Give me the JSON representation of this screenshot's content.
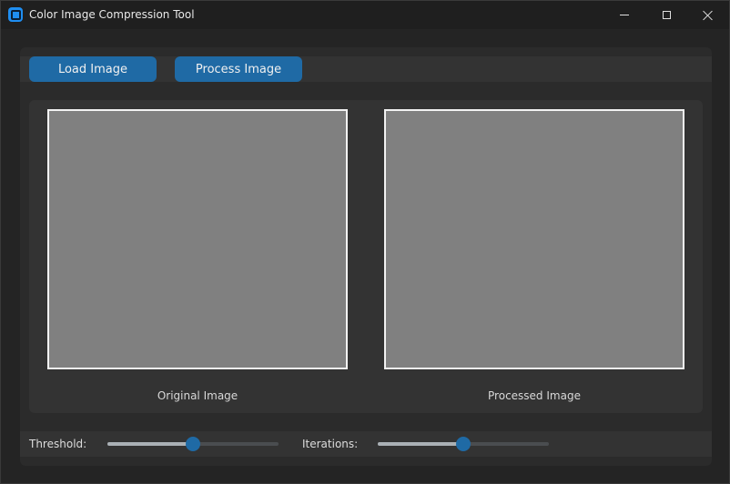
{
  "window": {
    "title": "Color Image Compression Tool"
  },
  "toolbar": {
    "load_label": "Load Image",
    "process_label": "Process Image"
  },
  "images": {
    "original_label": "Original Image",
    "processed_label": "Processed Image"
  },
  "controls": {
    "threshold_label": "Threshold:",
    "threshold_value_fraction": 0.5,
    "iterations_label": "Iterations:",
    "iterations_value_fraction": 0.5
  },
  "colors": {
    "accent": "#1f6aa5",
    "window_bg": "#242424",
    "panel_bg": "#333333",
    "image_placeholder": "#808080"
  },
  "icons": {
    "app": "app-icon",
    "minimize": "minimize-icon",
    "maximize": "maximize-icon",
    "close": "close-icon"
  }
}
